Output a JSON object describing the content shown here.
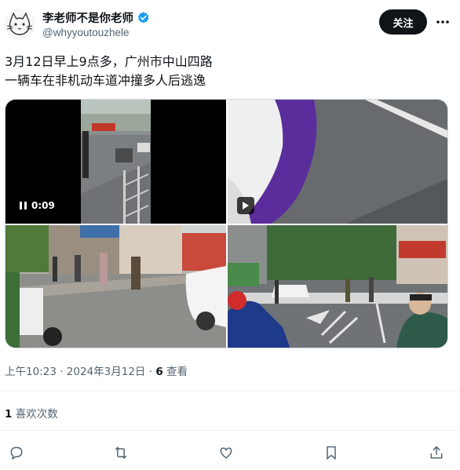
{
  "author": {
    "display_name": "李老师不是你老师",
    "handle": "@whyyoutouzhele",
    "verified": true
  },
  "header": {
    "follow_label": "关注",
    "more_icon": "more-dots-icon"
  },
  "tweet": {
    "lines": [
      "3月12日早上9点多，广州市中山四路",
      "一辆车在非机动车道冲撞多人后逃逸"
    ]
  },
  "media": {
    "video_time": "0:09",
    "tiles": [
      {
        "kind": "video",
        "icon": "pause-icon"
      },
      {
        "kind": "video",
        "icon": "play-icon"
      },
      {
        "kind": "photo"
      },
      {
        "kind": "photo"
      }
    ]
  },
  "meta": {
    "time": "上午10:23",
    "separator": "·",
    "date": "2024年3月12日",
    "views_count": "6",
    "views_label": "查看"
  },
  "likes": {
    "count": "1",
    "label": "喜欢次数"
  },
  "actions": [
    "reply-icon",
    "retweet-icon",
    "like-icon",
    "bookmark-icon",
    "share-icon"
  ],
  "colors": {
    "text": "#0f1419",
    "secondary": "#536471",
    "verified": "#1d9bf0",
    "follow_bg": "#0f1419",
    "divider": "#eff3f4"
  }
}
